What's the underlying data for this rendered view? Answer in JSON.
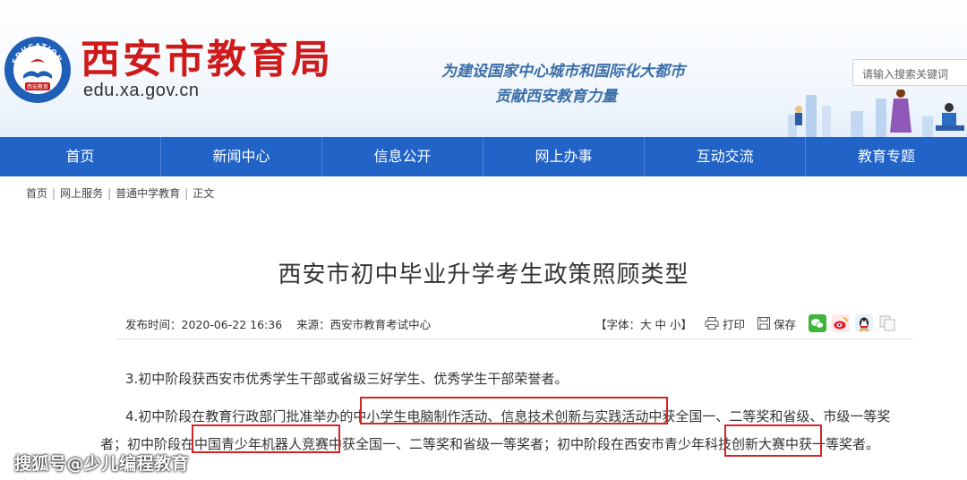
{
  "header": {
    "logo_text_top": "EDUCATION",
    "logo_text_bottom": "西安教育",
    "site_name": "西安市教育局",
    "site_domain": "edu.xa.gov.cn",
    "slogan_line1": "为建设国家中心城市和国际化大都市",
    "slogan_line2": "贡献西安教育力量",
    "search_placeholder": "请输入搜索关键词"
  },
  "nav": {
    "items": [
      "首页",
      "新闻中心",
      "信息公开",
      "网上办事",
      "互动交流",
      "教育专题"
    ]
  },
  "breadcrumb": [
    "首页",
    "网上服务",
    "普通中学教育",
    "正文"
  ],
  "article": {
    "title": "西安市初中毕业升学考生政策照顾类型",
    "published_label": "发布时间：",
    "published": "2020-06-22 16:36",
    "source_label": "来源：",
    "source": "西安市教育考试中心",
    "font_size_label": "【字体：大 中 小】",
    "print_label": "打印",
    "save_label": "保存",
    "para1": "3.初中阶段获西安市优秀学生干部或省级三好学生、优秀学生干部荣誉者。",
    "para2_line1": "4.初中阶段在教育行政部门批准举办的中小学生电脑制作活动、信息技术创新与实践活动中获全国一、二等奖和省级、市级一等奖",
    "para2_line2": "者；初中阶段在中国青少年机器人竞赛中获全国一、二等奖和省级一等奖者；初中阶段在西安市青少年科技创新大赛中获一等奖者。"
  },
  "watermark": "搜狐号@少儿编程教育",
  "colors": {
    "brand_red": "#cf1a1b",
    "nav_blue": "#2163c6",
    "highlight_red": "#d42426"
  }
}
